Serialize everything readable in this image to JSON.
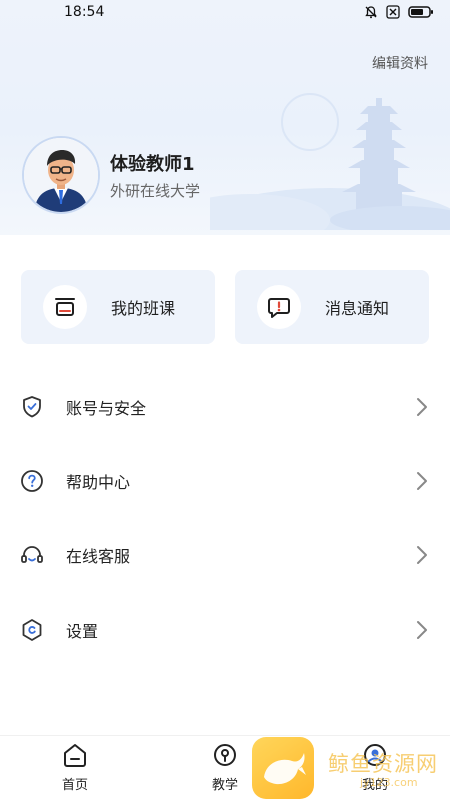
{
  "status_bar": {
    "time": "18:54",
    "icons": [
      "bell-off-icon",
      "close-box-icon",
      "battery-icon"
    ]
  },
  "profile": {
    "edit_label": "编辑资料",
    "name": "体验教师1",
    "organization": "外研在线大学"
  },
  "cards": [
    {
      "label": "我的班课",
      "icon": "classroom-icon"
    },
    {
      "label": "消息通知",
      "icon": "message-alert-icon"
    }
  ],
  "menu": [
    {
      "label": "账号与安全",
      "icon": "shield-check-icon"
    },
    {
      "label": "帮助中心",
      "icon": "question-icon"
    },
    {
      "label": "在线客服",
      "icon": "headset-icon"
    },
    {
      "label": "设置",
      "icon": "settings-hex-icon"
    }
  ],
  "tabs": [
    {
      "label": "首页",
      "icon": "home-icon"
    },
    {
      "label": "教学",
      "icon": "teaching-icon"
    },
    {
      "label": "我的",
      "icon": "profile-icon",
      "active": true
    }
  ],
  "watermark": {
    "text": "鲸鱼资源网",
    "sub": "jy123.com"
  },
  "colors": {
    "accent": "#3a6fd8",
    "card_bg": "#eef3fb",
    "hero_bg": "#eaf1fb",
    "alert_red": "#e04a3a"
  }
}
